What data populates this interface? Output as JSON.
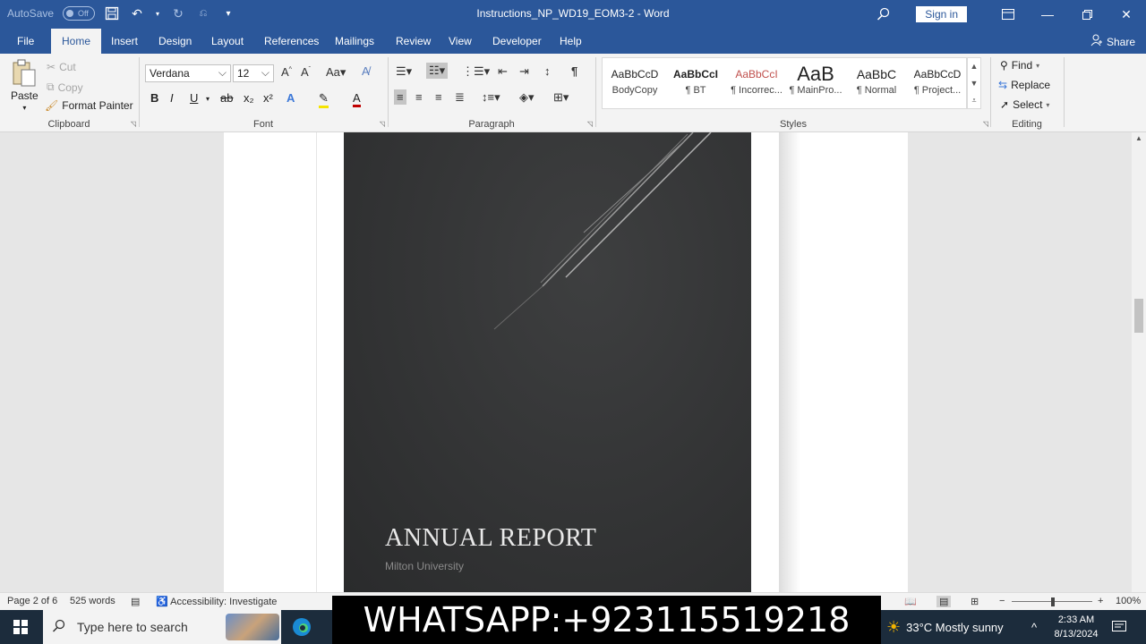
{
  "titlebar": {
    "autosave_label": "AutoSave",
    "autosave_state": "Off",
    "document_title": "Instructions_NP_WD19_EOM3-2  -  Word",
    "sign_in": "Sign in"
  },
  "tabs": [
    "File",
    "Home",
    "Insert",
    "Design",
    "Layout",
    "References",
    "Mailings",
    "Review",
    "View",
    "Developer",
    "Help"
  ],
  "active_tab": "Home",
  "share_label": "Share",
  "clipboard": {
    "paste": "Paste",
    "cut": "Cut",
    "copy": "Copy",
    "format_painter": "Format Painter",
    "group_label": "Clipboard"
  },
  "font": {
    "family": "Verdana",
    "size": "12",
    "group_label": "Font",
    "buttons": [
      "B",
      "I",
      "U",
      "ab",
      "x₂",
      "x²"
    ]
  },
  "paragraph": {
    "group_label": "Paragraph"
  },
  "styles": {
    "group_label": "Styles",
    "items": [
      {
        "preview": "AaBbCcD",
        "name": "BodyCopy"
      },
      {
        "preview": "AaBbCcI",
        "name": "¶ BT"
      },
      {
        "preview": "AaBbCcI",
        "name": "¶ Incorrec..."
      },
      {
        "preview": "AaB",
        "name": "¶ MainPro..."
      },
      {
        "preview": "AaBbC",
        "name": "¶ Normal"
      },
      {
        "preview": "AaBbCcD",
        "name": "¶ Project..."
      }
    ]
  },
  "editing": {
    "find": "Find",
    "replace": "Replace",
    "select": "Select",
    "group_label": "Editing"
  },
  "document": {
    "cover_title": "ANNUAL REPORT",
    "cover_subtitle": "Milton University"
  },
  "statusbar": {
    "page": "Page 2 of 6",
    "words": "525 words",
    "accessibility": "Accessibility: Investigate",
    "zoom": "100%"
  },
  "taskbar": {
    "search_placeholder": "Type here to search",
    "overlay_text": "WHATSAPP:+923115519218",
    "weather": "33°C  Mostly sunny",
    "time": "2:33 AM",
    "date": "8/13/2024"
  },
  "colors": {
    "word_blue": "#2b579a",
    "cover_bg": "#323334"
  }
}
